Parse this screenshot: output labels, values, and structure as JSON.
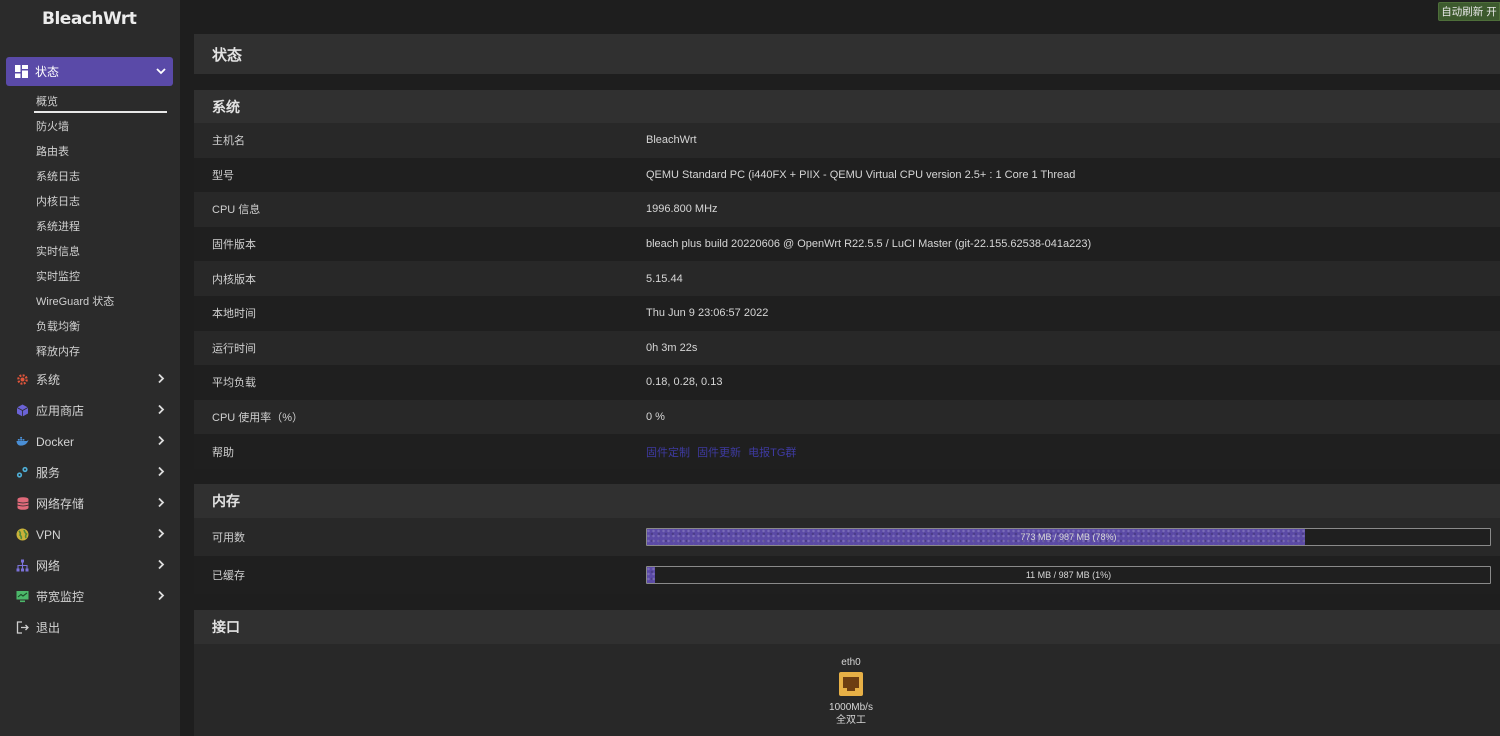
{
  "brand": "BleachWrt",
  "refresh_button": "自动刷新 开",
  "sidebar": {
    "status": {
      "label": "状态",
      "children": [
        "概览",
        "防火墙",
        "路由表",
        "系统日志",
        "内核日志",
        "系统进程",
        "实时信息",
        "实时监控",
        "WireGuard 状态",
        "负载均衡",
        "释放内存"
      ]
    },
    "items": [
      {
        "label": "系统",
        "icon": "gear-icon"
      },
      {
        "label": "应用商店",
        "icon": "cube-icon"
      },
      {
        "label": "Docker",
        "icon": "docker-icon"
      },
      {
        "label": "服务",
        "icon": "services-icon"
      },
      {
        "label": "网络存储",
        "icon": "database-icon"
      },
      {
        "label": "VPN",
        "icon": "globe-icon"
      },
      {
        "label": "网络",
        "icon": "network-icon"
      },
      {
        "label": "带宽监控",
        "icon": "monitor-icon"
      }
    ],
    "logout": "退出"
  },
  "page_title": "状态",
  "system": {
    "title": "系统",
    "rows": [
      {
        "key": "主机名",
        "value": "BleachWrt"
      },
      {
        "key": "型号",
        "value": "QEMU Standard PC (i440FX + PIIX - QEMU Virtual CPU version 2.5+ : 1 Core 1 Thread"
      },
      {
        "key": "CPU 信息",
        "value": "1996.800 MHz"
      },
      {
        "key": "固件版本",
        "value": "bleach plus build 20220606 @ OpenWrt R22.5.5 / LuCI Master (git-22.155.62538-041a223)"
      },
      {
        "key": "内核版本",
        "value": "5.15.44"
      },
      {
        "key": "本地时间",
        "value": "Thu Jun 9 23:06:57 2022"
      },
      {
        "key": "运行时间",
        "value": "0h 3m 22s"
      },
      {
        "key": "平均负载",
        "value": "0.18, 0.28, 0.13"
      },
      {
        "key": "CPU 使用率（%）",
        "value": "0 %"
      }
    ],
    "help": {
      "key": "帮助",
      "links": [
        "固件定制",
        "固件更新",
        "电报TG群"
      ]
    }
  },
  "memory": {
    "title": "内存",
    "available": {
      "key": "可用数",
      "text": "773 MB / 987 MB (78%)",
      "percent": 78
    },
    "cached": {
      "key": "已缓存",
      "text": "11 MB / 987 MB (1%)",
      "percent": 1
    }
  },
  "interfaces": {
    "title": "接口",
    "items": [
      {
        "name": "eth0",
        "speed": "1000Mb/s",
        "duplex": "全双工"
      }
    ]
  },
  "colors": {
    "accent": "#5a4aa8",
    "link": "#3e3aa0",
    "refresh": "#3d5a2e",
    "port": "#e7b046"
  }
}
